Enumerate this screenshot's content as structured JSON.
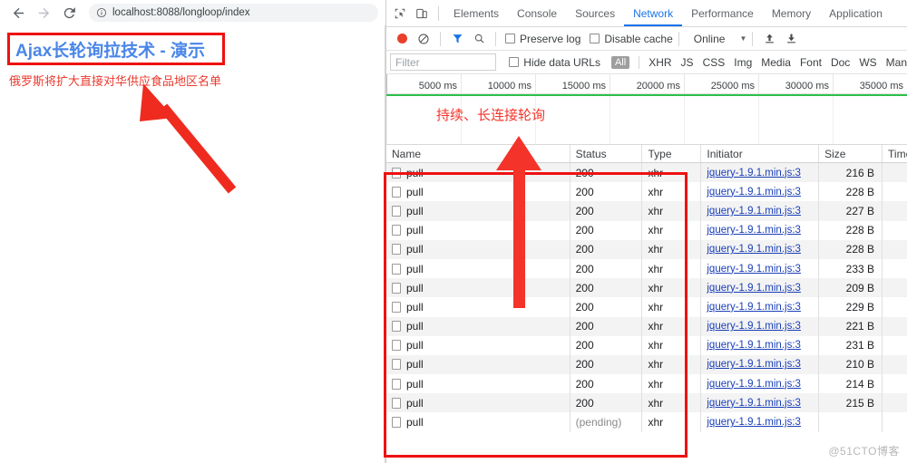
{
  "browser": {
    "back_label": "back-arrow",
    "forward_label": "forward-arrow",
    "reload_label": "reload",
    "url_scheme_icon": "info-circle",
    "url": "localhost:8088/longloop/index",
    "url_host": "localhost:8088",
    "url_path": "/longloop/index"
  },
  "page": {
    "title": "Ajax长轮询拉技术 - 演示",
    "title_color": "#4a86e8",
    "subtitle": "俄罗斯将扩大直接对华供应食品地区名单",
    "subtitle_color": "#ea3a2e",
    "annotation_color": "#ee1111"
  },
  "devtools": {
    "inspect_icon": "cursor-select-icon",
    "device_icon": "device-toggle-icon",
    "tabs": [
      {
        "label": "Elements",
        "active": false
      },
      {
        "label": "Console",
        "active": false
      },
      {
        "label": "Sources",
        "active": false
      },
      {
        "label": "Network",
        "active": true
      },
      {
        "label": "Performance",
        "active": false
      },
      {
        "label": "Memory",
        "active": false
      },
      {
        "label": "Application",
        "active": false
      }
    ],
    "toolbar": {
      "record_label": "record-button",
      "clear_label": "clear-button",
      "filter_label": "filter-button",
      "search_label": "search-button",
      "preserve_log": "Preserve log",
      "disable_cache": "Disable cache",
      "throttling": "Online",
      "import_label": "import-har",
      "export_label": "export-har"
    },
    "filterbar": {
      "filter_placeholder": "Filter",
      "hide_data_urls": "Hide data URLs",
      "chips": [
        "All",
        "XHR",
        "JS",
        "CSS",
        "Img",
        "Media",
        "Font",
        "Doc",
        "WS",
        "Man"
      ]
    },
    "timeline": {
      "ticks": [
        "5000 ms",
        "10000 ms",
        "15000 ms",
        "20000 ms",
        "25000 ms",
        "30000 ms",
        "35000 ms"
      ],
      "dom_content_loaded_color": "#2ec04b",
      "note": "持续、长连接轮询"
    },
    "table": {
      "columns": [
        "Name",
        "Status",
        "Type",
        "Initiator",
        "Size",
        "Time"
      ],
      "rows": [
        {
          "name": "pull",
          "status": "200",
          "type": "xhr",
          "initiator": "jquery-1.9.1.min.js:3",
          "size": "216 B",
          "time": ""
        },
        {
          "name": "pull",
          "status": "200",
          "type": "xhr",
          "initiator": "jquery-1.9.1.min.js:3",
          "size": "228 B",
          "time": ""
        },
        {
          "name": "pull",
          "status": "200",
          "type": "xhr",
          "initiator": "jquery-1.9.1.min.js:3",
          "size": "227 B",
          "time": ""
        },
        {
          "name": "pull",
          "status": "200",
          "type": "xhr",
          "initiator": "jquery-1.9.1.min.js:3",
          "size": "228 B",
          "time": ""
        },
        {
          "name": "pull",
          "status": "200",
          "type": "xhr",
          "initiator": "jquery-1.9.1.min.js:3",
          "size": "228 B",
          "time": ""
        },
        {
          "name": "pull",
          "status": "200",
          "type": "xhr",
          "initiator": "jquery-1.9.1.min.js:3",
          "size": "233 B",
          "time": ""
        },
        {
          "name": "pull",
          "status": "200",
          "type": "xhr",
          "initiator": "jquery-1.9.1.min.js:3",
          "size": "209 B",
          "time": ""
        },
        {
          "name": "pull",
          "status": "200",
          "type": "xhr",
          "initiator": "jquery-1.9.1.min.js:3",
          "size": "229 B",
          "time": ""
        },
        {
          "name": "pull",
          "status": "200",
          "type": "xhr",
          "initiator": "jquery-1.9.1.min.js:3",
          "size": "221 B",
          "time": ""
        },
        {
          "name": "pull",
          "status": "200",
          "type": "xhr",
          "initiator": "jquery-1.9.1.min.js:3",
          "size": "231 B",
          "time": ""
        },
        {
          "name": "pull",
          "status": "200",
          "type": "xhr",
          "initiator": "jquery-1.9.1.min.js:3",
          "size": "210 B",
          "time": ""
        },
        {
          "name": "pull",
          "status": "200",
          "type": "xhr",
          "initiator": "jquery-1.9.1.min.js:3",
          "size": "214 B",
          "time": ""
        },
        {
          "name": "pull",
          "status": "200",
          "type": "xhr",
          "initiator": "jquery-1.9.1.min.js:3",
          "size": "215 B",
          "time": ""
        },
        {
          "name": "pull",
          "status": "(pending)",
          "type": "xhr",
          "initiator": "jquery-1.9.1.min.js:3",
          "size": "",
          "time": ""
        }
      ]
    }
  },
  "watermark": "@51CTO博客"
}
